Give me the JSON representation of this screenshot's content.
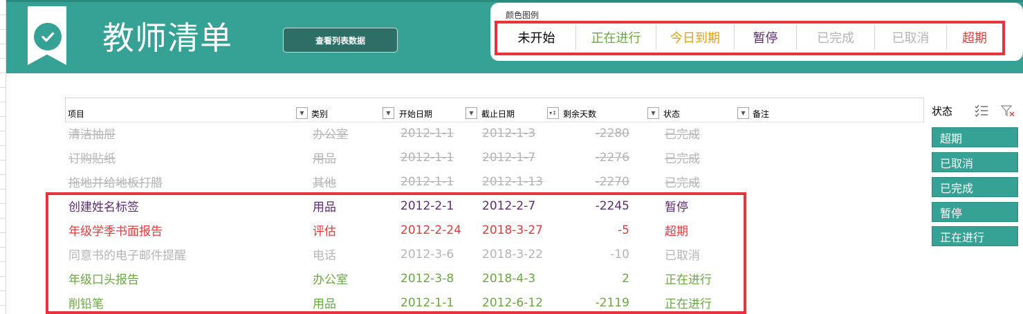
{
  "header": {
    "title": "教师清单",
    "view_button_label": "查看列表数据"
  },
  "legend": {
    "caption": "颜色图例",
    "items": [
      {
        "label": "未开始",
        "color": "#000000"
      },
      {
        "label": "正在进行",
        "color": "#6aa842"
      },
      {
        "label": "今日到期",
        "color": "#e4a20b"
      },
      {
        "label": "暂停",
        "color": "#5b2d6e"
      },
      {
        "label": "已完成",
        "color": "#b5b5b5"
      },
      {
        "label": "已取消",
        "color": "#b5b5b5"
      },
      {
        "label": "超期",
        "color": "#e03c3c"
      }
    ]
  },
  "table": {
    "columns": [
      "项目",
      "类别",
      "开始日期",
      "截止日期",
      "剩余天数",
      "状态",
      "备注"
    ],
    "rows": [
      {
        "item": "清洁抽屉",
        "category": "办公室",
        "start": "2012-1-1",
        "due": "2012-1-3",
        "days": "-2280",
        "status": "已完成",
        "style": "done"
      },
      {
        "item": "订购贴纸",
        "category": "用品",
        "start": "2012-1-1",
        "due": "2012-1-7",
        "days": "-2276",
        "status": "已完成",
        "style": "done"
      },
      {
        "item": "拖地并给地板打腊",
        "category": "其他",
        "start": "2012-1-1",
        "due": "2012-1-13",
        "days": "-2270",
        "status": "已完成",
        "style": "done"
      },
      {
        "item": "创建姓名标签",
        "category": "用品",
        "start": "2012-2-1",
        "due": "2012-2-7",
        "days": "-2245",
        "status": "暂停",
        "style": "paused"
      },
      {
        "item": "年级学季书面报告",
        "category": "评估",
        "start": "2012-2-24",
        "due": "2018-3-27",
        "days": "-5",
        "status": "超期",
        "style": "overdue"
      },
      {
        "item": "同意书的电子邮件提醒",
        "category": "电话",
        "start": "2012-3-6",
        "due": "2018-3-22",
        "days": "-10",
        "status": "已取消",
        "style": "cancelled"
      },
      {
        "item": "年级口头报告",
        "category": "办公室",
        "start": "2012-3-8",
        "due": "2018-4-3",
        "days": "2",
        "status": "正在进行",
        "style": "inprogress"
      },
      {
        "item": "削铅笔",
        "category": "用品",
        "start": "2012-1-1",
        "due": "2012-6-12",
        "days": "-2119",
        "status": "正在进行",
        "style": "inprogress"
      }
    ]
  },
  "slicer": {
    "title": "状态",
    "options": [
      "超期",
      "已取消",
      "已完成",
      "暂停",
      "正在进行"
    ]
  },
  "colors": {
    "banner": "#35a295",
    "highlight_frame": "#e8333a",
    "done": "#b5b5b5",
    "paused": "#5b2d6e",
    "overdue": "#e03c3c",
    "cancelled": "#b5b5b5",
    "inprogress": "#6aa842"
  }
}
